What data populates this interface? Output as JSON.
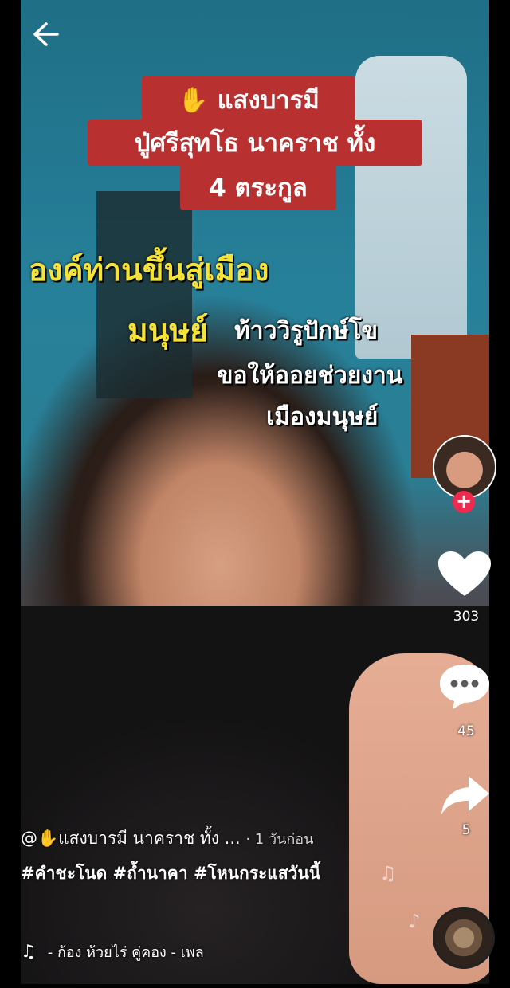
{
  "nav": {
    "back_icon": "arrow-left-icon"
  },
  "captions": {
    "box_lines": [
      "✋ แสงบารมี",
      "ปู่ศรีสุทโธ นาคราช ทั้ง",
      "4 ตระกูล"
    ],
    "yellow_line_1": "องค์ท่านขึ้นสู่เมือง",
    "yellow_line_2": "มนุษย์",
    "white_line_1": "ท้าววิรูปักษ์โข",
    "white_line_2": "ขอให้ออยช่วยงาน",
    "white_line_3": "เมืองมนุษย์",
    "box_color": "#b8302f",
    "yellow_color": "#f5e338"
  },
  "rail": {
    "follow_label": "+",
    "likes": "303",
    "comments": "45",
    "shares": "5",
    "like_icon": "heart-icon",
    "comment_icon": "comment-icon",
    "share_icon": "share-icon"
  },
  "post": {
    "username": "@✋แสงบารมี นาคราช ทั้ง ...",
    "time": "· 1 วันก่อน",
    "hashtags": "#คำชะโนด #ถ้ำนาคา #โหนกระแสวันนี้",
    "music": "- ก้อง ห้วยไร่   คู่คอง - เพล"
  }
}
